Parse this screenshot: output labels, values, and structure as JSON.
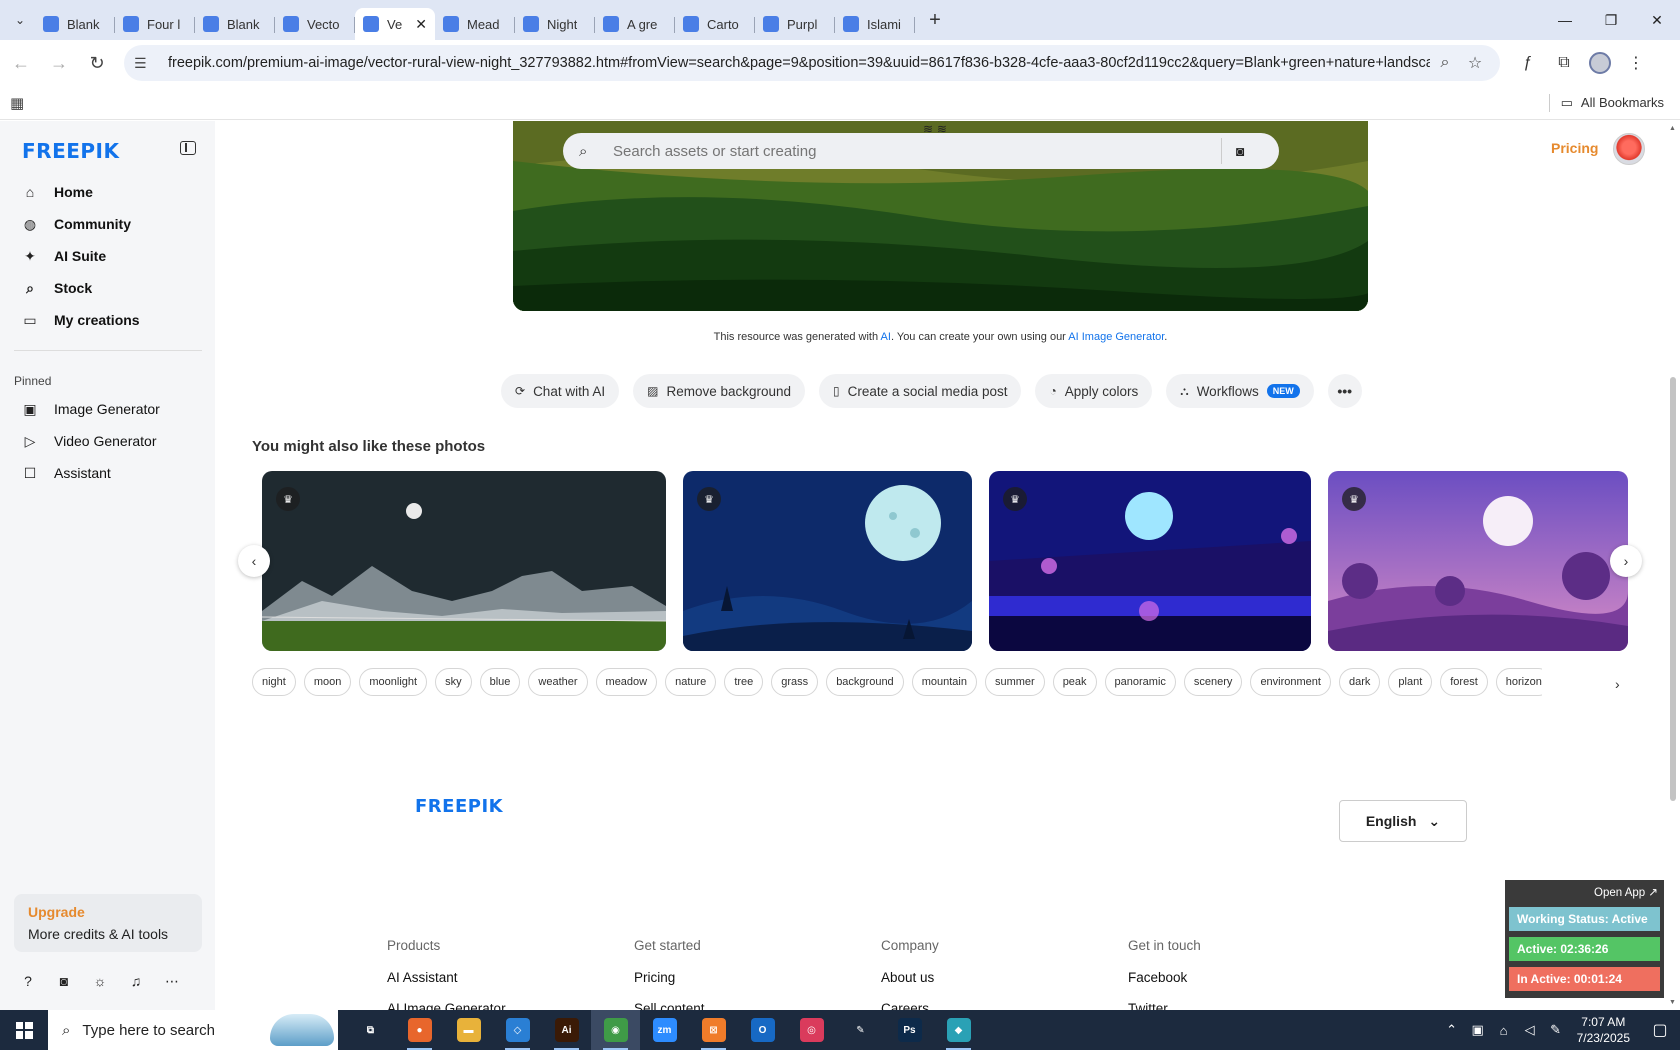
{
  "browser": {
    "tabs": [
      {
        "type": "pinned",
        "icon": "wordpress-icon",
        "fav": "grey"
      },
      {
        "type": "pinned",
        "icon": "sheets-icon",
        "fav": "sheet"
      },
      {
        "type": "pinned",
        "icon": "docs-icon",
        "fav": "doc"
      },
      {
        "type": "pinned",
        "icon": "docs-icon",
        "fav": "doc"
      },
      {
        "type": "pinned",
        "icon": "docs-icon",
        "fav": "doc"
      },
      {
        "type": "pinned",
        "icon": "orange-app-icon",
        "fav": "orange"
      },
      {
        "type": "pinned",
        "icon": "teal-app-icon",
        "fav": "teal"
      },
      {
        "type": "pinned",
        "icon": "chatgpt-icon",
        "fav": "grey"
      },
      {
        "type": "pinned",
        "icon": "sheets-icon",
        "fav": "sheet"
      },
      {
        "type": "pinned",
        "icon": "hand-icon",
        "fav": "orange"
      },
      {
        "type": "pinned",
        "icon": "chart-icon",
        "fav": "chart"
      },
      {
        "type": "pinned",
        "icon": "docs-icon",
        "fav": "doc"
      },
      {
        "type": "normal",
        "title": "Blank",
        "fav": "doc"
      },
      {
        "type": "normal",
        "title": "Four l",
        "fav": "doc"
      },
      {
        "type": "normal",
        "title": "Blank",
        "fav": "doc"
      },
      {
        "type": "normal",
        "title": "Vecto",
        "fav": "doc"
      },
      {
        "type": "active",
        "title": "Ve",
        "fav": "doc"
      },
      {
        "type": "normal",
        "title": "Mead",
        "fav": "doc"
      },
      {
        "type": "normal",
        "title": "Night",
        "fav": "doc"
      },
      {
        "type": "normal",
        "title": "A gre",
        "fav": "doc"
      },
      {
        "type": "normal",
        "title": "Carto",
        "fav": "doc"
      },
      {
        "type": "normal",
        "title": "Purpl",
        "fav": "doc"
      },
      {
        "type": "normal",
        "title": "Islami",
        "fav": "doc"
      }
    ],
    "url": "freepik.com/premium-ai-image/vector-rural-view-night_327793882.htm#fromView=search&page=9&position=39&uuid=8617f836-b328-4cfe-aaa3-80cf2d119cc2&query=Blank+green+nature+landscape...",
    "all_bookmarks": "All Bookmarks"
  },
  "sidebar": {
    "logo": "FREEPIK",
    "nav": [
      {
        "label": "Home",
        "icon": "home-icon",
        "glyph": "⌂"
      },
      {
        "label": "Community",
        "icon": "globe-icon",
        "glyph": "◍"
      },
      {
        "label": "AI Suite",
        "icon": "sparkle-icon",
        "glyph": "✦"
      },
      {
        "label": "Stock",
        "icon": "search-icon",
        "glyph": "⌕"
      },
      {
        "label": "My creations",
        "icon": "folder-icon",
        "glyph": "▭"
      }
    ],
    "pinned_label": "Pinned",
    "pinned": [
      {
        "label": "Image Generator",
        "icon": "image-icon",
        "glyph": "▣"
      },
      {
        "label": "Video Generator",
        "icon": "video-icon",
        "glyph": "▷"
      },
      {
        "label": "Assistant",
        "icon": "chat-icon",
        "glyph": "☐"
      }
    ],
    "upgrade": {
      "title": "Upgrade",
      "subtitle": "More credits & AI tools"
    }
  },
  "header": {
    "search_placeholder": "Search assets or start creating",
    "pricing": "Pricing"
  },
  "main": {
    "ai_note": {
      "prefix": "This resource was generated with ",
      "link1": "AI",
      "middle": ". You can create your own using our ",
      "link2": "AI Image Generator",
      "suffix": "."
    },
    "actions": [
      {
        "label": "Chat with AI",
        "icon": "chat-icon",
        "glyph": "⟳"
      },
      {
        "label": "Remove background",
        "icon": "eraser-icon",
        "glyph": "▨"
      },
      {
        "label": "Create a social media post",
        "icon": "phone-icon",
        "glyph": "▯"
      },
      {
        "label": "Apply colors",
        "icon": "palette-icon",
        "glyph": "◔"
      },
      {
        "label": "Workflows",
        "icon": "workflow-icon",
        "glyph": "⛬",
        "badge": "NEW"
      }
    ],
    "more": "•••",
    "section_title": "You might also like these photos",
    "tags": [
      "night",
      "moon",
      "moonlight",
      "sky",
      "blue",
      "weather",
      "meadow",
      "nature",
      "tree",
      "grass",
      "background",
      "mountain",
      "summer",
      "peak",
      "panoramic",
      "scenery",
      "environment",
      "dark",
      "plant",
      "forest",
      "horizon"
    ]
  },
  "footer": {
    "logo": "FREEPIK",
    "language": "English",
    "columns": [
      {
        "heading": "Products",
        "first": "AI Assistant",
        "second": "AI Image Generator"
      },
      {
        "heading": "Get started",
        "first": "Pricing",
        "second": "Sell content"
      },
      {
        "heading": "Company",
        "first": "About us",
        "second": "Careers"
      },
      {
        "heading": "Get in touch",
        "first": "Facebook",
        "second": "Twitter"
      }
    ]
  },
  "widget": {
    "open_app": "Open App ↗",
    "status": "Working Status: Active",
    "active": "Active: 02:36:26",
    "inactive": "In Active: 00:01:24"
  },
  "taskbar": {
    "search_placeholder": "Type here to search",
    "time": "7:07 AM",
    "date": "7/23/2025",
    "apps": [
      {
        "name": "task-view-icon",
        "label": "⧉",
        "color": "transparent"
      },
      {
        "name": "firefox-icon",
        "label": "●",
        "color": "#e8662c"
      },
      {
        "name": "file-explorer-icon",
        "label": "▬",
        "color": "#e8b23a"
      },
      {
        "name": "vscode-icon",
        "label": "◇",
        "color": "#2a7fd4"
      },
      {
        "name": "illustrator-icon",
        "label": "Ai",
        "color": "#3a1a06"
      },
      {
        "name": "chrome-icon",
        "label": "◉",
        "color": "#3f9b47"
      },
      {
        "name": "zoom-icon",
        "label": "zm",
        "color": "#2d8cff"
      },
      {
        "name": "xampp-icon",
        "label": "⊠",
        "color": "#f07c2a"
      },
      {
        "name": "outlook-icon",
        "label": "O",
        "color": "#1769c4"
      },
      {
        "name": "creative-cloud-icon",
        "label": "◎",
        "color": "#da3b5c"
      },
      {
        "name": "pen-tool-icon",
        "label": "✎",
        "color": "transparent"
      },
      {
        "name": "photoshop-icon",
        "label": "Ps",
        "color": "#0d2a4a"
      },
      {
        "name": "app-icon",
        "label": "◆",
        "color": "#2aa1b5"
      }
    ]
  }
}
